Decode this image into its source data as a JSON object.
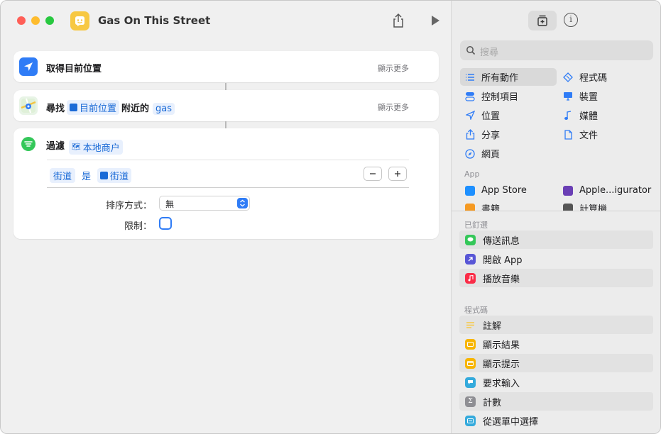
{
  "window": {
    "title": "Gas On This Street"
  },
  "actions": [
    {
      "label": "取得目前位置",
      "show_more": "顯示更多"
    },
    {
      "prefix": "尋找",
      "token1": "目前位置",
      "middle": "附近的",
      "token2": "gas",
      "show_more": "顯示更多"
    },
    {
      "prefix": "過濾",
      "token1": "本地商户"
    }
  ],
  "filter": {
    "field": "街道",
    "operator": "是",
    "value": "街道",
    "sort_label": "排序方式：",
    "sort_value": "無",
    "limit_label": "限制："
  },
  "library": {
    "search_placeholder": "搜尋",
    "categories_left": [
      "所有動作",
      "控制項目",
      "位置",
      "分享",
      "網頁"
    ],
    "categories_right": [
      "程式碼",
      "裝置",
      "媒體",
      "文件"
    ],
    "app_header": "App",
    "apps": [
      "App Store",
      "Apple...igurator",
      "書籍",
      "計算機"
    ],
    "pinned_header": "已釘選",
    "pinned": [
      "傳送訊息",
      "開啟 App",
      "播放音樂"
    ],
    "scripting_header": "程式碼",
    "scripting": [
      "註解",
      "顯示結果",
      "顯示提示",
      "要求輸入",
      "計數",
      "從選單中選擇"
    ]
  },
  "colors": {
    "accent": "#2f7cf6",
    "token_bg": "#e8f0fd",
    "token_text": "#1a6ad6"
  }
}
